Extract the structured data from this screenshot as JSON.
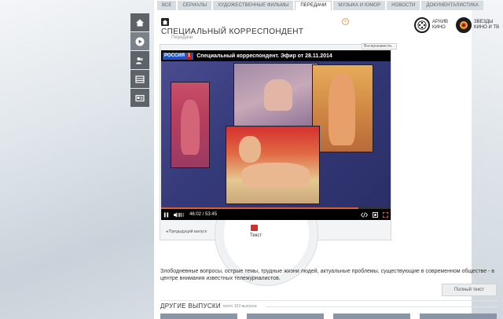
{
  "nav": {
    "tabs": [
      {
        "label": "ВСЕ",
        "active": false
      },
      {
        "label": "СЕРИАЛЫ",
        "active": false
      },
      {
        "label": "ХУДОЖЕСТВЕННЫЕ ФИЛЬМЫ",
        "active": false
      },
      {
        "label": "ПЕРЕДАЧИ",
        "active": true
      },
      {
        "label": "МУЗЫКА И ЮМОР",
        "active": false
      },
      {
        "label": "НОВОСТИ",
        "active": false
      },
      {
        "label": "ДОКУМЕНТАЛИСТИКА",
        "active": false
      }
    ]
  },
  "rail": {
    "icons": [
      "home-icon",
      "play-icon",
      "people-icon",
      "film-icon",
      "card-icon"
    ]
  },
  "header": {
    "title": "СПЕЦИАЛЬНЫЙ КОРРЕСПОНДЕНТ",
    "subtitle": "Передачи",
    "archive_line1": "АРХИВ",
    "archive_line2": "КИНО",
    "stars_line1": "ЗВЕЗДЫ",
    "stars_line2": "КИНО И ТВ"
  },
  "player": {
    "share_label": "Воспроизвести...",
    "channel_logo": "РОССИЯ",
    "channel_number": "1",
    "video_title": "Специальный корреспондент. Эфир от 28.11.2014",
    "current_time": "46:02",
    "total_time": "53:45",
    "progress": 0.86,
    "prev_label": "Предыдущий выпуск",
    "text_label": "Текст"
  },
  "description": {
    "text": "Злободневные вопросы, острые темы, трудные жизни людей, актуальные проблемы, существующие в современном обществе - в центре внимания известных тележурналистов.",
    "full_text_button": "Полный текст"
  },
  "other": {
    "title": "ДРУГИЕ ВЫПУСКИ",
    "count": "всего 163 выпуска"
  },
  "colors": {
    "accent": "#e45b2a",
    "rail": "#5d6369",
    "channel_blue": "#1a54c6",
    "channel_red": "#d01b1b"
  }
}
